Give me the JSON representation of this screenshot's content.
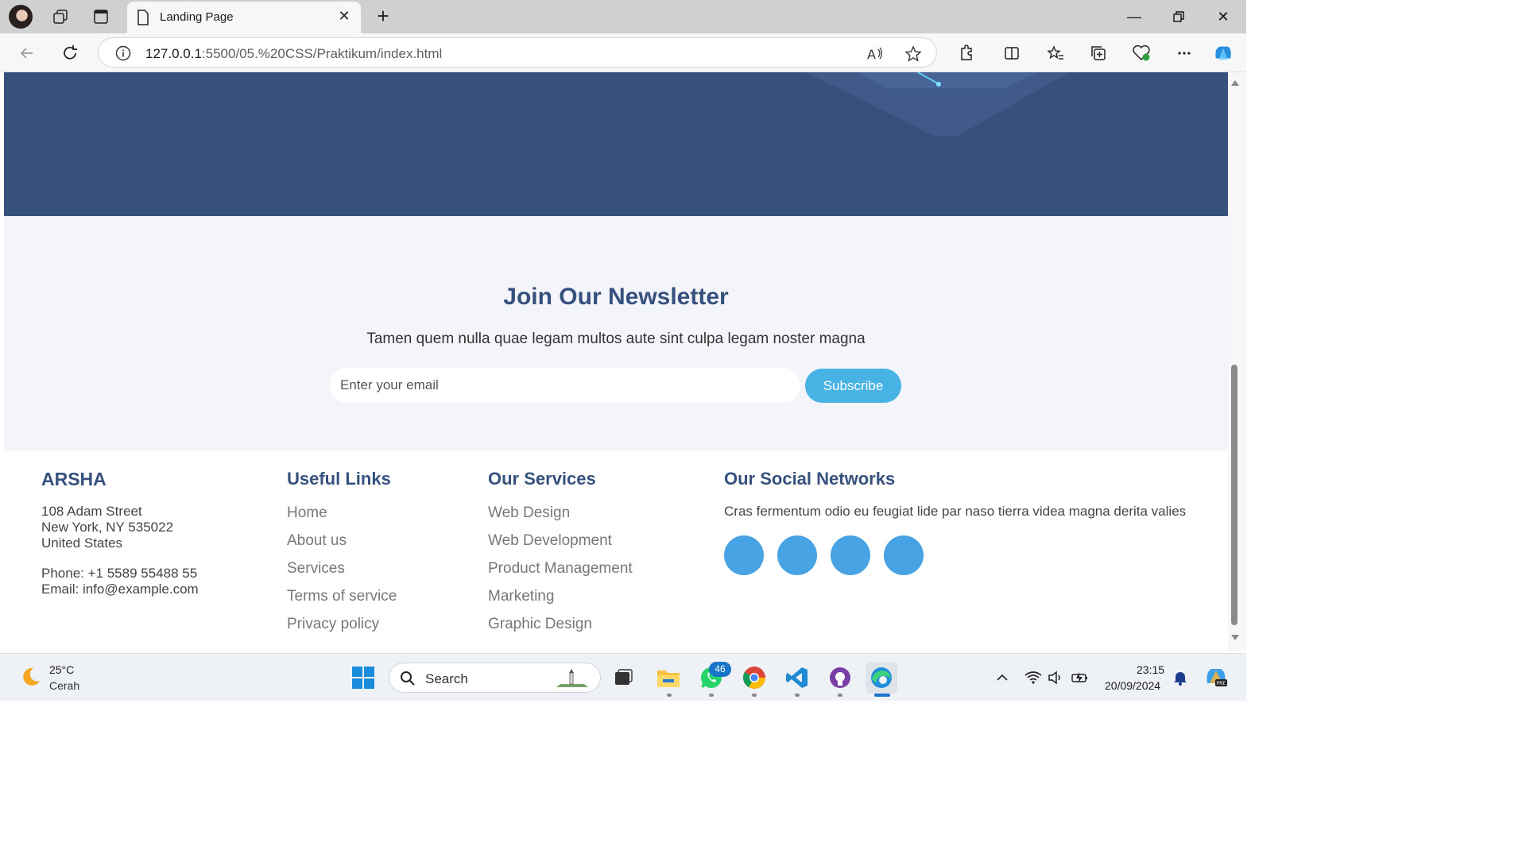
{
  "browser": {
    "tab_title": "Landing Page",
    "url_host": "127.0.0.1",
    "url_rest": ":5500/05.%20CSS/Praktikum/index.html"
  },
  "newsletter": {
    "title": "Join Our Newsletter",
    "subtitle": "Tamen quem nulla quae legam multos aute sint culpa legam noster magna",
    "email_placeholder": "Enter your email",
    "subscribe_label": "Subscribe"
  },
  "footer": {
    "brand": "ARSHA",
    "address": [
      "108 Adam Street",
      "New York, NY 535022",
      "United States"
    ],
    "phone": "Phone: +1 5589 55488 55",
    "email": "Email: info@example.com",
    "useful_links": {
      "title": "Useful Links",
      "items": [
        "Home",
        "About us",
        "Services",
        "Terms of service",
        "Privacy policy"
      ]
    },
    "services": {
      "title": "Our Services",
      "items": [
        "Web Design",
        "Web Development",
        "Product Management",
        "Marketing",
        "Graphic Design"
      ]
    },
    "social": {
      "title": "Our Social Networks",
      "text": "Cras fermentum odio eu feugiat lide par naso tierra videa magna derita valies",
      "icons": [
        "twitter-icon",
        "facebook-icon",
        "instagram-icon",
        "linkedin-icon"
      ]
    }
  },
  "colors": {
    "hero": "#37517e",
    "accent": "#47b2e4",
    "heading": "#37517e"
  },
  "taskbar": {
    "weather_temp": "25°C",
    "weather_desc": "Cerah",
    "search_label": "Search",
    "whatsapp_badge": "46",
    "time": "23:15",
    "date": "20/09/2024"
  }
}
